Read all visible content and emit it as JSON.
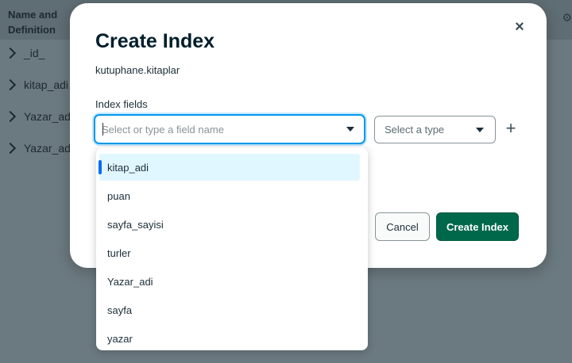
{
  "background": {
    "column_title": "Name and Definition",
    "right_edge_glyph": "⚙",
    "rows": [
      "_id_",
      "kitap_adi",
      "Yazar_adi",
      "Yazar_adi"
    ]
  },
  "modal": {
    "title": "Create Index",
    "namespace": "kutuphane.kitaplar",
    "fields_label": "Index fields",
    "field_placeholder": "Select or type a field name",
    "type_placeholder": "Select a type",
    "plus_label": "+",
    "close_label": "×",
    "cancel_label": "Cancel",
    "create_label": "Create Index"
  },
  "dropdown": {
    "options": [
      "kitap_adi",
      "puan",
      "sayfa_sayisi",
      "turler",
      "Yazar_adi",
      "sayfa",
      "yazar"
    ],
    "active_index": 0
  },
  "colors": {
    "primary_green": "#00684a",
    "focus_blue": "#0498ec",
    "active_bar": "#016bf8",
    "active_bg": "#e1f7ff"
  }
}
